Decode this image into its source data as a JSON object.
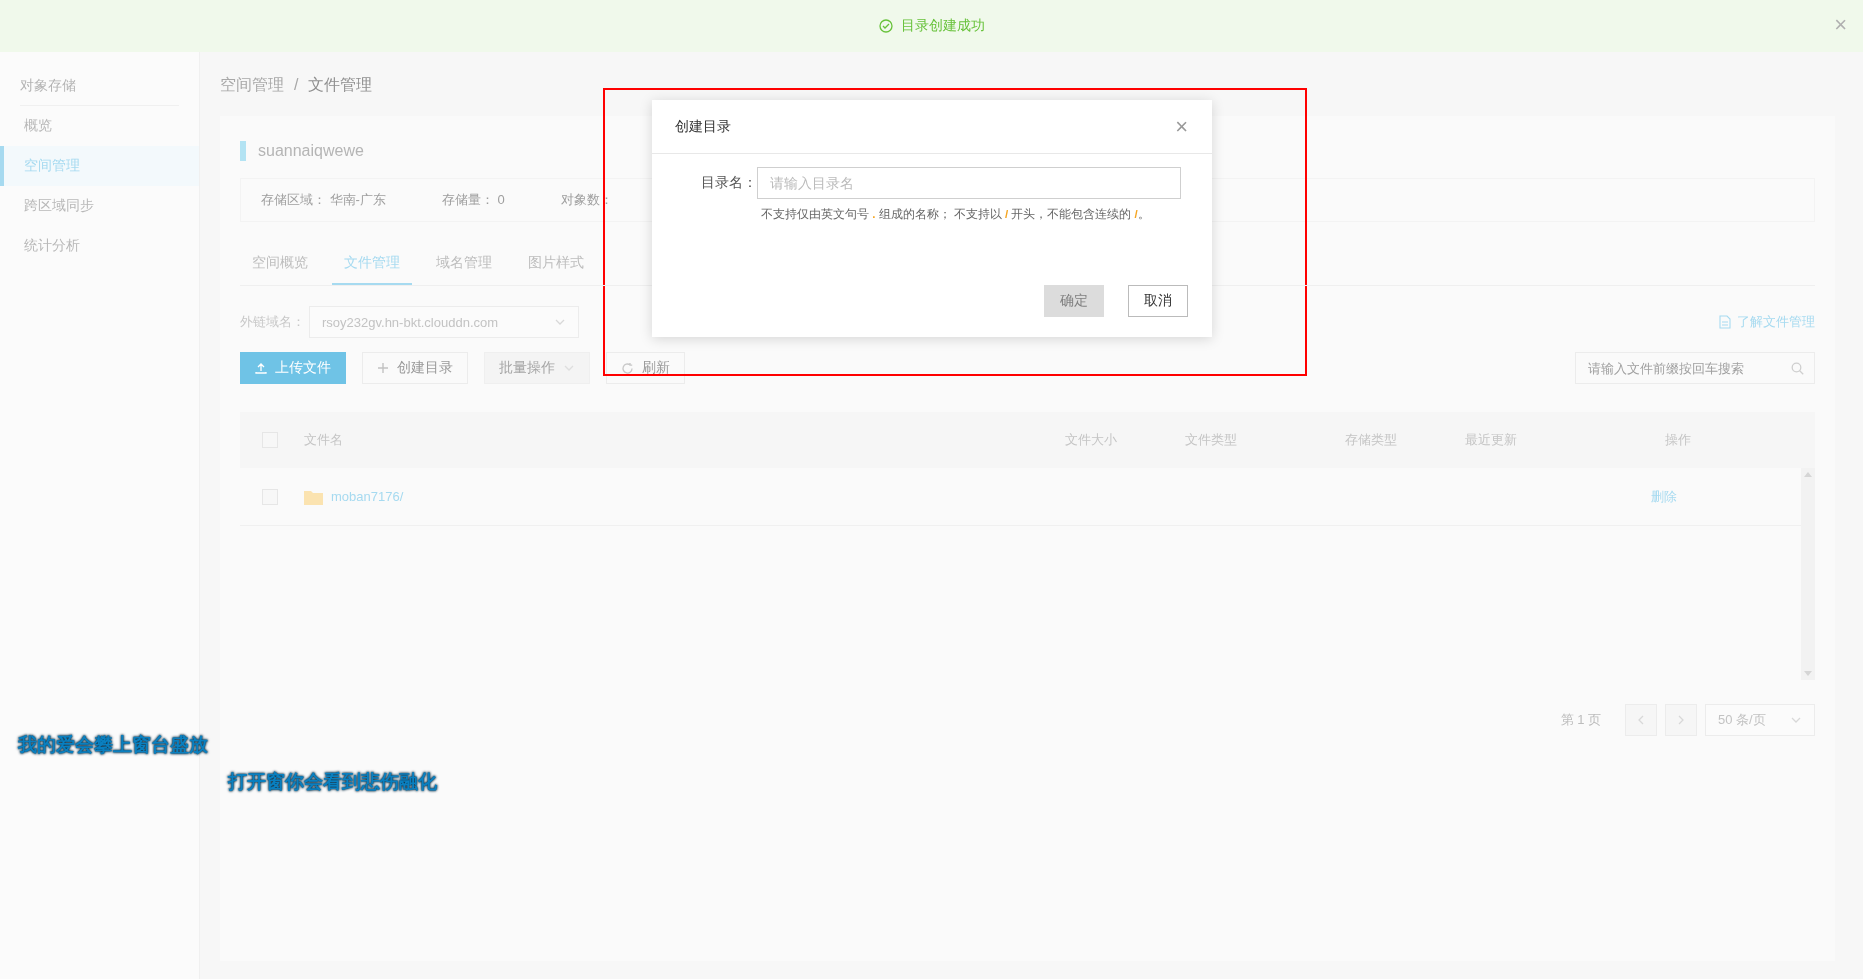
{
  "toast": {
    "message": "目录创建成功",
    "close": "×"
  },
  "sidebar": {
    "title": "对象存储",
    "items": [
      {
        "label": "概览",
        "selected": false
      },
      {
        "label": "空间管理",
        "selected": true
      },
      {
        "label": "跨区域同步",
        "selected": false
      },
      {
        "label": "统计分析",
        "selected": false
      }
    ]
  },
  "breadcrumb": [
    "空间管理",
    "文件管理"
  ],
  "breadcrumb_separator": "/",
  "bucket": {
    "name": "suannaiqwewe",
    "info": [
      {
        "label": "存储区域：",
        "value": "华南-广东"
      },
      {
        "label": "存储量：",
        "value": "0"
      },
      {
        "label": "对象数："
      }
    ]
  },
  "tabs": [
    {
      "label": "空间概览",
      "selected": false
    },
    {
      "label": "文件管理",
      "selected": true
    },
    {
      "label": "域名管理",
      "selected": false
    },
    {
      "label": "图片样式",
      "selected": false
    }
  ],
  "domain": {
    "label": "外链域名：",
    "value": "rsoy232gv.hn-bkt.clouddn.com"
  },
  "help_link": "了解文件管理",
  "toolbar": [
    {
      "label": "上传文件",
      "kind": "primary",
      "disabled": false
    },
    {
      "label": "创建目录",
      "kind": "plus",
      "disabled": false
    },
    {
      "label": "批量操作",
      "kind": "dropdown",
      "disabled": true
    },
    {
      "label": "刷新",
      "kind": "refresh",
      "disabled": false
    }
  ],
  "search": {
    "placeholder": "请输入文件前缀按回车搜索"
  },
  "table": {
    "select_all_checked": false,
    "columns": [
      "文件名",
      "文件大小",
      "文件类型",
      "存储类型",
      "最近更新",
      "操作"
    ],
    "rows": [
      {
        "name": "moban7176/",
        "kind": "folder",
        "checked": false,
        "action": "删除"
      }
    ]
  },
  "pagination": {
    "page": "第 1 页",
    "page_size": "50 条/页"
  },
  "dialog": {
    "title": "创建目录",
    "close": "×",
    "field_label": "目录名：",
    "placeholder": "请输入目录名",
    "hint": "不支持仅由英文句号 **.** 组成的名称； 不支持以 **/** 开头，不能包含连续的 **/**。",
    "buttons": [
      {
        "label": "确定",
        "disabled": true
      },
      {
        "label": "取消",
        "disabled": false
      }
    ]
  },
  "lyrics": [
    "我的爱会攀上窗台盛放",
    "打开窗你会看到悲伤融化"
  ]
}
